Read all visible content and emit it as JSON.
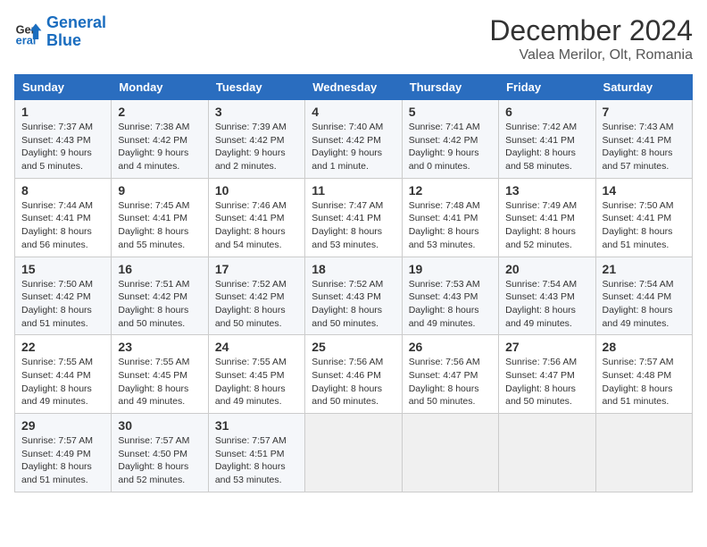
{
  "logo": {
    "line1": "General",
    "line2": "Blue"
  },
  "title": "December 2024",
  "subtitle": "Valea Merilor, Olt, Romania",
  "days_of_week": [
    "Sunday",
    "Monday",
    "Tuesday",
    "Wednesday",
    "Thursday",
    "Friday",
    "Saturday"
  ],
  "weeks": [
    [
      {
        "day": "1",
        "info": "Sunrise: 7:37 AM\nSunset: 4:43 PM\nDaylight: 9 hours\nand 5 minutes."
      },
      {
        "day": "2",
        "info": "Sunrise: 7:38 AM\nSunset: 4:42 PM\nDaylight: 9 hours\nand 4 minutes."
      },
      {
        "day": "3",
        "info": "Sunrise: 7:39 AM\nSunset: 4:42 PM\nDaylight: 9 hours\nand 2 minutes."
      },
      {
        "day": "4",
        "info": "Sunrise: 7:40 AM\nSunset: 4:42 PM\nDaylight: 9 hours\nand 1 minute."
      },
      {
        "day": "5",
        "info": "Sunrise: 7:41 AM\nSunset: 4:42 PM\nDaylight: 9 hours\nand 0 minutes."
      },
      {
        "day": "6",
        "info": "Sunrise: 7:42 AM\nSunset: 4:41 PM\nDaylight: 8 hours\nand 58 minutes."
      },
      {
        "day": "7",
        "info": "Sunrise: 7:43 AM\nSunset: 4:41 PM\nDaylight: 8 hours\nand 57 minutes."
      }
    ],
    [
      {
        "day": "8",
        "info": "Sunrise: 7:44 AM\nSunset: 4:41 PM\nDaylight: 8 hours\nand 56 minutes."
      },
      {
        "day": "9",
        "info": "Sunrise: 7:45 AM\nSunset: 4:41 PM\nDaylight: 8 hours\nand 55 minutes."
      },
      {
        "day": "10",
        "info": "Sunrise: 7:46 AM\nSunset: 4:41 PM\nDaylight: 8 hours\nand 54 minutes."
      },
      {
        "day": "11",
        "info": "Sunrise: 7:47 AM\nSunset: 4:41 PM\nDaylight: 8 hours\nand 53 minutes."
      },
      {
        "day": "12",
        "info": "Sunrise: 7:48 AM\nSunset: 4:41 PM\nDaylight: 8 hours\nand 53 minutes."
      },
      {
        "day": "13",
        "info": "Sunrise: 7:49 AM\nSunset: 4:41 PM\nDaylight: 8 hours\nand 52 minutes."
      },
      {
        "day": "14",
        "info": "Sunrise: 7:50 AM\nSunset: 4:41 PM\nDaylight: 8 hours\nand 51 minutes."
      }
    ],
    [
      {
        "day": "15",
        "info": "Sunrise: 7:50 AM\nSunset: 4:42 PM\nDaylight: 8 hours\nand 51 minutes."
      },
      {
        "day": "16",
        "info": "Sunrise: 7:51 AM\nSunset: 4:42 PM\nDaylight: 8 hours\nand 50 minutes."
      },
      {
        "day": "17",
        "info": "Sunrise: 7:52 AM\nSunset: 4:42 PM\nDaylight: 8 hours\nand 50 minutes."
      },
      {
        "day": "18",
        "info": "Sunrise: 7:52 AM\nSunset: 4:43 PM\nDaylight: 8 hours\nand 50 minutes."
      },
      {
        "day": "19",
        "info": "Sunrise: 7:53 AM\nSunset: 4:43 PM\nDaylight: 8 hours\nand 49 minutes."
      },
      {
        "day": "20",
        "info": "Sunrise: 7:54 AM\nSunset: 4:43 PM\nDaylight: 8 hours\nand 49 minutes."
      },
      {
        "day": "21",
        "info": "Sunrise: 7:54 AM\nSunset: 4:44 PM\nDaylight: 8 hours\nand 49 minutes."
      }
    ],
    [
      {
        "day": "22",
        "info": "Sunrise: 7:55 AM\nSunset: 4:44 PM\nDaylight: 8 hours\nand 49 minutes."
      },
      {
        "day": "23",
        "info": "Sunrise: 7:55 AM\nSunset: 4:45 PM\nDaylight: 8 hours\nand 49 minutes."
      },
      {
        "day": "24",
        "info": "Sunrise: 7:55 AM\nSunset: 4:45 PM\nDaylight: 8 hours\nand 49 minutes."
      },
      {
        "day": "25",
        "info": "Sunrise: 7:56 AM\nSunset: 4:46 PM\nDaylight: 8 hours\nand 50 minutes."
      },
      {
        "day": "26",
        "info": "Sunrise: 7:56 AM\nSunset: 4:47 PM\nDaylight: 8 hours\nand 50 minutes."
      },
      {
        "day": "27",
        "info": "Sunrise: 7:56 AM\nSunset: 4:47 PM\nDaylight: 8 hours\nand 50 minutes."
      },
      {
        "day": "28",
        "info": "Sunrise: 7:57 AM\nSunset: 4:48 PM\nDaylight: 8 hours\nand 51 minutes."
      }
    ],
    [
      {
        "day": "29",
        "info": "Sunrise: 7:57 AM\nSunset: 4:49 PM\nDaylight: 8 hours\nand 51 minutes."
      },
      {
        "day": "30",
        "info": "Sunrise: 7:57 AM\nSunset: 4:50 PM\nDaylight: 8 hours\nand 52 minutes."
      },
      {
        "day": "31",
        "info": "Sunrise: 7:57 AM\nSunset: 4:51 PM\nDaylight: 8 hours\nand 53 minutes."
      },
      {
        "day": "",
        "info": ""
      },
      {
        "day": "",
        "info": ""
      },
      {
        "day": "",
        "info": ""
      },
      {
        "day": "",
        "info": ""
      }
    ]
  ]
}
